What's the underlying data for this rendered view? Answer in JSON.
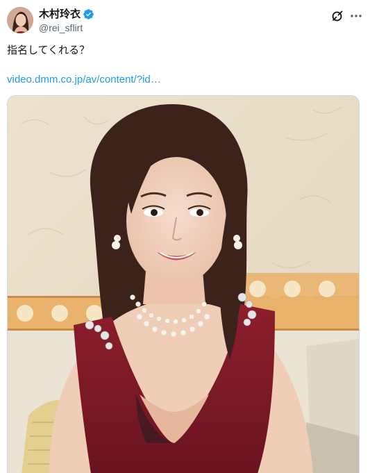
{
  "tweet": {
    "author": {
      "display_name": "木村玲衣",
      "handle": "@rei_sflirt",
      "verified": true
    },
    "text": "指名してくれる？",
    "link": "video.dmm.co.jp/av/content/?id…"
  },
  "icons": {
    "verified": "verified-badge-icon",
    "grok": "grok-icon",
    "more": "more-options-icon"
  },
  "colors": {
    "link": "#1d9bf0",
    "verified": "#1d9bf0",
    "secondary_text": "#536471"
  }
}
